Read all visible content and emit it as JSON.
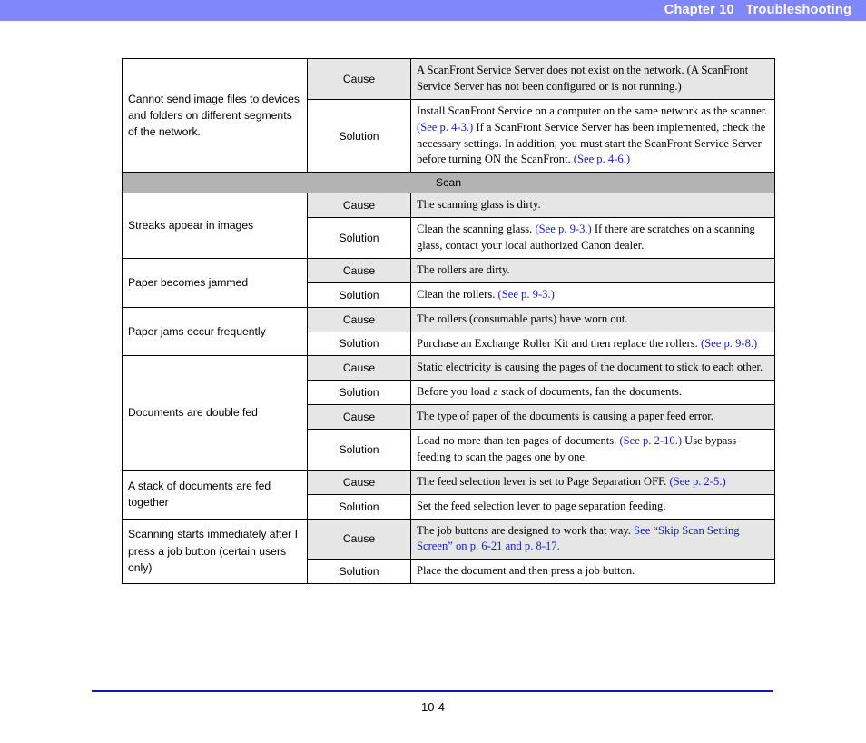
{
  "header": {
    "chapter_label": "Chapter 10",
    "chapter_title": "Troubleshooting",
    "full_title": "Chapter 10   Troubleshooting",
    "background_color": "#7f87fb",
    "text_color": "#ffffff"
  },
  "colors": {
    "link": "#1818d8",
    "cause_row_background": "#e6e6e6",
    "section_row_background": "#b3b3b3",
    "footer_rule": "#1616b4",
    "border": "#000000"
  },
  "table": {
    "labels": {
      "cause": "Cause",
      "solution": "Solution"
    },
    "blocks": [
      {
        "type": "entry",
        "symptom": "Cannot send image files to devices and folders on different segments of the network.",
        "rows": [
          {
            "kind": "Cause",
            "segments": [
              {
                "text": "A ScanFront Service Server does not exist on the network. (A ScanFront Service Server has not been configured or is not running.)",
                "link": false
              }
            ]
          },
          {
            "kind": "Solution",
            "segments": [
              {
                "text": "Install ScanFront Service on a computer on the same network as the scanner. ",
                "link": false
              },
              {
                "text": "(See p. 4-3.)",
                "link": true
              },
              {
                "text": " If a ScanFront Service Server has been implemented, check the necessary settings. In addition, you must start the ScanFront Service Server before turning ON the ScanFront. ",
                "link": false
              },
              {
                "text": "(See p. 4-6.)",
                "link": true
              }
            ]
          }
        ]
      },
      {
        "type": "section",
        "title": "Scan"
      },
      {
        "type": "entry",
        "symptom": "Streaks appear in images",
        "rows": [
          {
            "kind": "Cause",
            "segments": [
              {
                "text": "The scanning glass is dirty.",
                "link": false
              }
            ]
          },
          {
            "kind": "Solution",
            "segments": [
              {
                "text": "Clean the scanning glass. ",
                "link": false
              },
              {
                "text": "(See p. 9-3.)",
                "link": true
              },
              {
                "text": " If there are scratches on a scanning glass, contact your local authorized Canon dealer.",
                "link": false
              }
            ]
          }
        ]
      },
      {
        "type": "entry",
        "symptom": "Paper becomes jammed",
        "rows": [
          {
            "kind": "Cause",
            "segments": [
              {
                "text": "The rollers are dirty.",
                "link": false
              }
            ]
          },
          {
            "kind": "Solution",
            "segments": [
              {
                "text": "Clean the rollers. ",
                "link": false
              },
              {
                "text": "(See p. 9-3.)",
                "link": true
              }
            ]
          }
        ]
      },
      {
        "type": "entry",
        "symptom": "Paper jams occur frequently",
        "rows": [
          {
            "kind": "Cause",
            "segments": [
              {
                "text": "The rollers (consumable parts) have worn out.",
                "link": false
              }
            ]
          },
          {
            "kind": "Solution",
            "segments": [
              {
                "text": "Purchase an Exchange Roller Kit and then replace the rollers. ",
                "link": false
              },
              {
                "text": "(See p. 9-8.)",
                "link": true
              }
            ]
          }
        ]
      },
      {
        "type": "entry",
        "symptom": "Documents are double fed",
        "rows": [
          {
            "kind": "Cause",
            "segments": [
              {
                "text": "Static electricity is causing the pages of the document to stick to each other.",
                "link": false
              }
            ]
          },
          {
            "kind": "Solution",
            "segments": [
              {
                "text": "Before you load a stack of documents, fan the documents.",
                "link": false
              }
            ]
          },
          {
            "kind": "Cause",
            "segments": [
              {
                "text": "The type of paper of the documents is causing a paper feed error.",
                "link": false
              }
            ]
          },
          {
            "kind": "Solution",
            "segments": [
              {
                "text": "Load no more than ten pages of documents. ",
                "link": false
              },
              {
                "text": "(See p. 2-10.)",
                "link": true
              },
              {
                "text": " Use bypass feeding to scan the pages one by one.",
                "link": false
              }
            ]
          }
        ]
      },
      {
        "type": "entry",
        "symptom": "A stack of documents are fed together",
        "rows": [
          {
            "kind": "Cause",
            "segments": [
              {
                "text": "The feed selection lever is set to Page Separation OFF. ",
                "link": false
              },
              {
                "text": "(See p. 2-5.)",
                "link": true
              }
            ]
          },
          {
            "kind": "Solution",
            "segments": [
              {
                "text": "Set the feed selection lever to page separation feeding.",
                "link": false
              }
            ]
          }
        ]
      },
      {
        "type": "entry",
        "symptom": "Scanning starts immediately after I press a job button (certain users only)",
        "rows": [
          {
            "kind": "Cause",
            "segments": [
              {
                "text": "The job buttons are designed to work that way. ",
                "link": false
              },
              {
                "text": "See “Skip Scan Setting Screen” on p. 6-21 and p. 8-17.",
                "link": true
              }
            ]
          },
          {
            "kind": "Solution",
            "segments": [
              {
                "text": "Place the document and then press a job button.",
                "link": false
              }
            ]
          }
        ]
      }
    ]
  },
  "footer": {
    "page_number": "10-4"
  }
}
